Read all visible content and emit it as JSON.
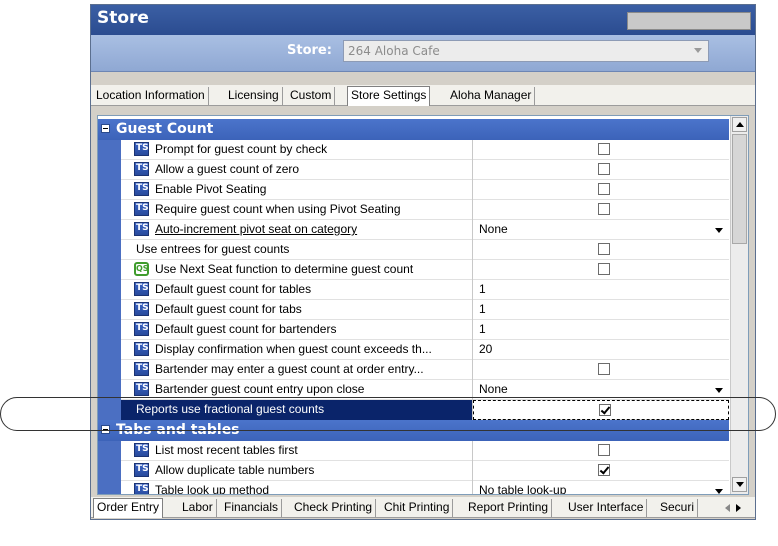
{
  "window": {
    "title": "Store"
  },
  "store": {
    "label": "Store:",
    "value": "264 Aloha Cafe"
  },
  "top_tabs": [
    {
      "label": "Location Information"
    },
    {
      "label": "Licensing"
    },
    {
      "label": "Custom"
    },
    {
      "label": "Store Settings",
      "active": true
    },
    {
      "label": "Aloha Manager"
    }
  ],
  "sections": [
    {
      "title": "Guest Count"
    },
    {
      "title": "Tabs and tables"
    }
  ],
  "rows": [
    {
      "icon": "ts-icon",
      "label": "Prompt for guest count by check",
      "type": "checkbox",
      "checked": false
    },
    {
      "icon": "ts-icon",
      "label": "Allow a guest count of zero",
      "type": "checkbox",
      "checked": false
    },
    {
      "icon": "ts-icon",
      "label": "Enable Pivot Seating",
      "type": "checkbox",
      "checked": false
    },
    {
      "icon": "ts-icon",
      "label": "Require guest count when using Pivot Seating",
      "type": "checkbox",
      "checked": false
    },
    {
      "icon": "ts-icon",
      "label": "Auto-increment pivot seat on category",
      "type": "dropdown",
      "value": "None",
      "link": true
    },
    {
      "icon": "",
      "label": "Use entrees for guest counts",
      "type": "checkbox",
      "checked": false
    },
    {
      "icon": "qs-icon",
      "label": "Use Next Seat function to determine guest count",
      "type": "checkbox",
      "checked": false
    },
    {
      "icon": "ts-icon",
      "label": "Default guest count for tables",
      "type": "text",
      "value": "1"
    },
    {
      "icon": "ts-icon",
      "label": "Default guest count for tabs",
      "type": "text",
      "value": "1"
    },
    {
      "icon": "ts-icon",
      "label": "Default guest count for bartenders",
      "type": "text",
      "value": "1"
    },
    {
      "icon": "ts-icon",
      "label": "Display confirmation when guest count exceeds th...",
      "type": "text",
      "value": "20"
    },
    {
      "icon": "ts-icon",
      "label": "Bartender may enter a guest count at order entry...",
      "type": "checkbox",
      "checked": false
    },
    {
      "icon": "ts-icon",
      "label": "Bartender guest count entry upon close",
      "type": "dropdown",
      "value": "None"
    },
    {
      "icon": "",
      "label": "Reports use fractional guest counts",
      "type": "checkbox",
      "checked": true,
      "selected": true
    },
    {
      "icon": "ts-icon",
      "label": "List most recent tables first",
      "type": "checkbox",
      "checked": false
    },
    {
      "icon": "ts-icon",
      "label": "Allow duplicate table numbers",
      "type": "checkbox",
      "checked": true
    },
    {
      "icon": "ts-icon",
      "label": "Table look up method",
      "type": "dropdown",
      "value": "No table look-up"
    }
  ],
  "bottom_tabs": [
    {
      "label": "Order Entry",
      "active": true
    },
    {
      "label": "Labor"
    },
    {
      "label": "Financials"
    },
    {
      "label": "Check Printing"
    },
    {
      "label": "Chit Printing"
    },
    {
      "label": "Report Printing"
    },
    {
      "label": "User Interface"
    },
    {
      "label": "Securi"
    }
  ]
}
